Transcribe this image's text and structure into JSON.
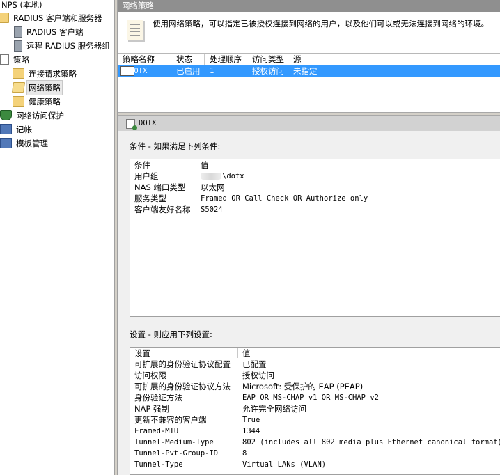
{
  "tree": {
    "root": "NPS (本地)",
    "radius_group": "RADIUS 客户端和服务器",
    "radius_clients": "RADIUS 客户端",
    "remote_radius": "远程 RADIUS 服务器组",
    "policies": "策略",
    "connection_request": "连接请求策略",
    "network_policies": "网络策略",
    "health_policies": "健康策略",
    "nap": "网络访问保护",
    "accounting": "记帐",
    "templates": "模板管理"
  },
  "header": {
    "title": "网络策略"
  },
  "description": "使用网络策略，可以指定已被授权连接到网络的用户，以及他们可以或无法连接到网络的环境。",
  "grid": {
    "columns": [
      "策略名称",
      "状态",
      "处理顺序",
      "访问类型",
      "源"
    ],
    "rows": [
      {
        "name": "DOTX",
        "status": "已启用",
        "order": "1",
        "access": "授权访问",
        "source": "未指定"
      }
    ]
  },
  "detail": {
    "title": "DOTX",
    "conditions_label": "条件 - 如果满足下列条件:",
    "conditions_columns": [
      "条件",
      "值"
    ],
    "conditions": [
      {
        "k": "用户组",
        "v": "\\dotx"
      },
      {
        "k": "NAS 端口类型",
        "v": "以太网"
      },
      {
        "k": "服务类型",
        "v": "Framed OR Call Check OR Authorize only"
      },
      {
        "k": "客户端友好名称",
        "v": "S5024"
      }
    ],
    "settings_label": "设置 - 则应用下列设置:",
    "settings_columns": [
      "设置",
      "值"
    ],
    "settings": [
      {
        "k": "可扩展的身份验证协议配置",
        "v": "已配置"
      },
      {
        "k": "访问权限",
        "v": "授权访问"
      },
      {
        "k": "可扩展的身份验证协议方法",
        "v": "Microsoft: 受保护的 EAP (PEAP)"
      },
      {
        "k": "身份验证方法",
        "v": "EAP OR MS-CHAP v1 OR MS-CHAP v2"
      },
      {
        "k": "NAP 强制",
        "v": "允许完全网络访问"
      },
      {
        "k": "更新不兼容的客户端",
        "v": "True"
      },
      {
        "k": "Framed-MTU",
        "v": "1344"
      },
      {
        "k": "Tunnel-Medium-Type",
        "v": "802 (includes all 802 media plus Ethernet canonical format)"
      },
      {
        "k": "Tunnel-Pvt-Group-ID",
        "v": "8"
      },
      {
        "k": "Tunnel-Type",
        "v": "Virtual LANs (VLAN)"
      }
    ]
  },
  "colors": {
    "selection": "#3399ff",
    "header_bg": "#8f8f8f",
    "detail_header_bg": "#d2d2d2"
  }
}
